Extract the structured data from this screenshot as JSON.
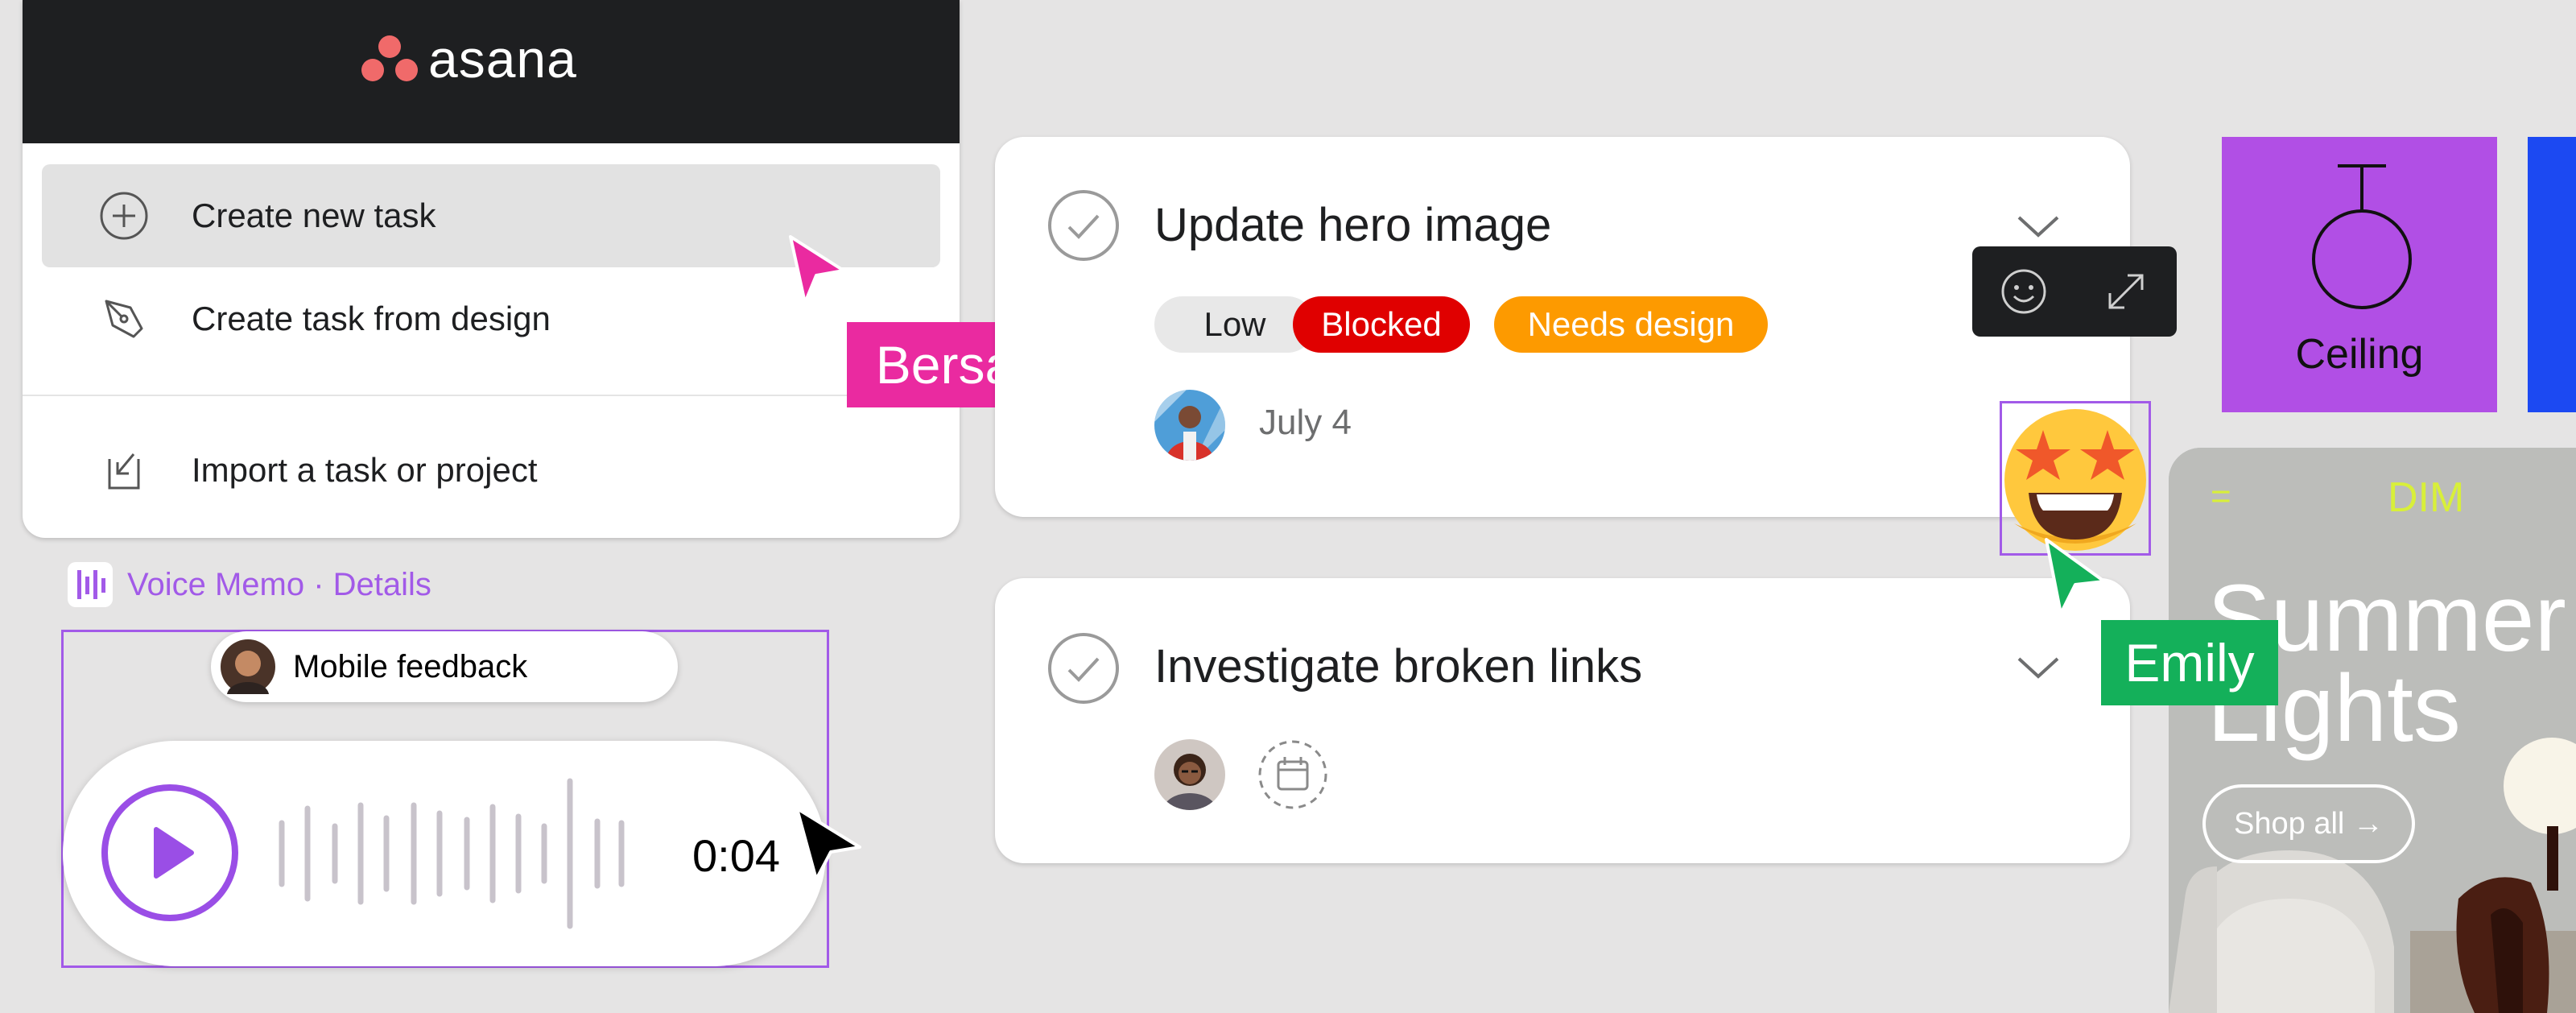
{
  "brand": {
    "logo_text": "asana",
    "logo_color": "#f06a6a"
  },
  "menu": {
    "items": [
      {
        "label": "Create new task",
        "icon": "plus-circle-icon"
      },
      {
        "label": "Create task from design",
        "icon": "pen-tool-icon"
      },
      {
        "label": "Import a task or project",
        "icon": "import-icon"
      }
    ]
  },
  "voice_memo": {
    "title": "Voice Memo · Details",
    "chip_label": "Mobile feedback",
    "duration": "0:04",
    "accent": "#a25ae8"
  },
  "tasks": [
    {
      "title": "Update hero image",
      "tags": [
        {
          "label": "Low",
          "color": "#e8e8e8"
        },
        {
          "label": "Blocked",
          "color": "#e00000"
        },
        {
          "label": "Needs design",
          "color": "#fd9a00"
        }
      ],
      "due": "July 4"
    },
    {
      "title": "Investigate broken links"
    }
  ],
  "collaborators": {
    "bersabel": {
      "name": "Bersabel",
      "color": "#ea2aa0"
    },
    "emily": {
      "name": "Emily",
      "color": "#14b05a"
    }
  },
  "reaction_bar": {
    "icons": [
      "smiley-icon",
      "expand-icon"
    ]
  },
  "ceiling_card": {
    "label": "Ceiling",
    "color": "#b14fe5"
  },
  "promo": {
    "menu_glyph": "=",
    "brand": "DIM",
    "heading": "Summer Lights",
    "button": "Shop all →"
  }
}
